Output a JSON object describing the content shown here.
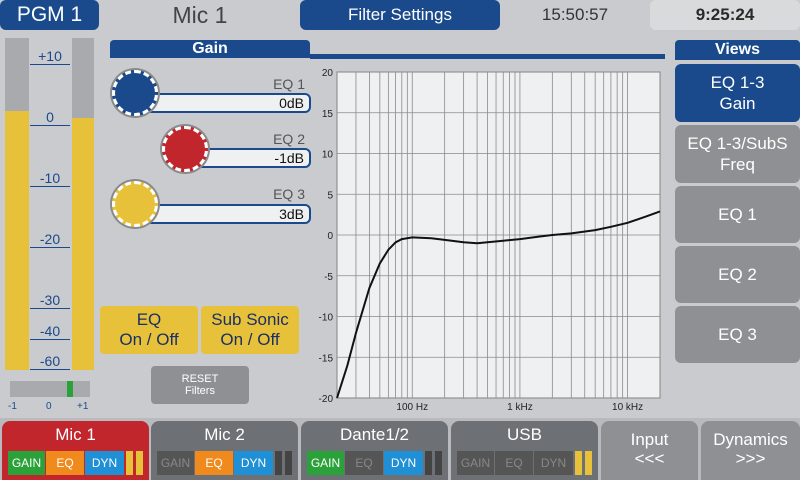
{
  "header": {
    "program": "PGM 1",
    "channel": "Mic 1",
    "page": "Filter Settings",
    "clock1": "15:50:57",
    "clock2": "9:25:24"
  },
  "meter": {
    "scale_labels": [
      "+10",
      "0",
      "-10",
      "-20",
      "-30",
      "-40",
      "-60"
    ],
    "balance_labels": [
      "-1",
      "0",
      "+1"
    ],
    "left_level_fraction": 0.78,
    "right_level_fraction": 0.76
  },
  "gain": {
    "title": "Gain",
    "bands": [
      {
        "label": "EQ 1",
        "value": "0dB",
        "color": "#1a4a8c"
      },
      {
        "label": "EQ 2",
        "value": "-1dB",
        "color": "#c0262c"
      },
      {
        "label": "EQ 3",
        "value": "3dB",
        "color": "#e8c13a"
      }
    ]
  },
  "buttons": {
    "eq": [
      "EQ",
      "On / Off"
    ],
    "subsonic": [
      "Sub Sonic",
      "On / Off"
    ],
    "reset": [
      "RESET",
      "Filters"
    ]
  },
  "chart_data": {
    "type": "line",
    "y_ticks": [
      "20",
      "15",
      "10",
      "5",
      "0",
      "-5",
      "-10",
      "-15",
      "-20"
    ],
    "x_ticks": [
      "100 Hz",
      "1 kHz",
      "10 kHz"
    ],
    "ylim": [
      -20,
      20
    ],
    "xlim": [
      20,
      20000
    ],
    "x_scale": "log",
    "grid": true,
    "series": [
      {
        "x": [
          20,
          25,
          30,
          40,
          50,
          60,
          70,
          80,
          100,
          150,
          200,
          300,
          400,
          500,
          700,
          1000,
          1500,
          2000,
          3000,
          5000,
          7000,
          10000,
          15000,
          20000
        ],
        "y": [
          -20,
          -16,
          -12,
          -6.5,
          -3.5,
          -1.8,
          -0.9,
          -0.5,
          -0.3,
          -0.4,
          -0.6,
          -0.9,
          -1.0,
          -0.9,
          -0.7,
          -0.5,
          -0.2,
          0,
          0.2,
          0.6,
          1.0,
          1.5,
          2.3,
          2.9
        ]
      }
    ]
  },
  "views": {
    "title": "Views",
    "items": [
      {
        "lines": [
          "EQ 1-3",
          "Gain"
        ],
        "active": true
      },
      {
        "lines": [
          "EQ 1-3/SubS",
          "Freq"
        ],
        "active": false
      },
      {
        "lines": [
          "EQ 1"
        ],
        "active": false
      },
      {
        "lines": [
          "EQ 2"
        ],
        "active": false
      },
      {
        "lines": [
          "EQ 3"
        ],
        "active": false
      }
    ]
  },
  "channels": [
    {
      "name": "Mic 1",
      "bg": "#c0262c",
      "tags": [
        {
          "t": "GAIN",
          "c": "#2ba139",
          "f": "#fff"
        },
        {
          "t": "EQ",
          "c": "#f18a1d",
          "f": "#fff"
        },
        {
          "t": "DYN",
          "c": "#1f8fd6",
          "f": "#fff"
        }
      ],
      "bars": [
        "#e8c13a",
        "#e8c13a"
      ]
    },
    {
      "name": "Mic 2",
      "bg": "#6d7175",
      "tags": [
        {
          "t": "GAIN",
          "c": "#555",
          "f": "#888"
        },
        {
          "t": "EQ",
          "c": "#f18a1d",
          "f": "#fff"
        },
        {
          "t": "DYN",
          "c": "#1f8fd6",
          "f": "#fff"
        }
      ],
      "bars": [
        "#444",
        "#444"
      ]
    },
    {
      "name": "Dante1/2",
      "bg": "#6d7175",
      "tags": [
        {
          "t": "GAIN",
          "c": "#2ba139",
          "f": "#fff"
        },
        {
          "t": "EQ",
          "c": "#555",
          "f": "#888"
        },
        {
          "t": "DYN",
          "c": "#1f8fd6",
          "f": "#fff"
        }
      ],
      "bars": [
        "#444",
        "#444"
      ]
    },
    {
      "name": "USB",
      "bg": "#6d7175",
      "tags": [
        {
          "t": "GAIN",
          "c": "#555",
          "f": "#888"
        },
        {
          "t": "EQ",
          "c": "#555",
          "f": "#888"
        },
        {
          "t": "DYN",
          "c": "#555",
          "f": "#888"
        }
      ],
      "bars": [
        "#e8c13a",
        "#e8c13a"
      ]
    }
  ],
  "nav": {
    "input": [
      "Input",
      "<<<"
    ],
    "dynamics": [
      "Dynamics",
      ">>>"
    ]
  }
}
